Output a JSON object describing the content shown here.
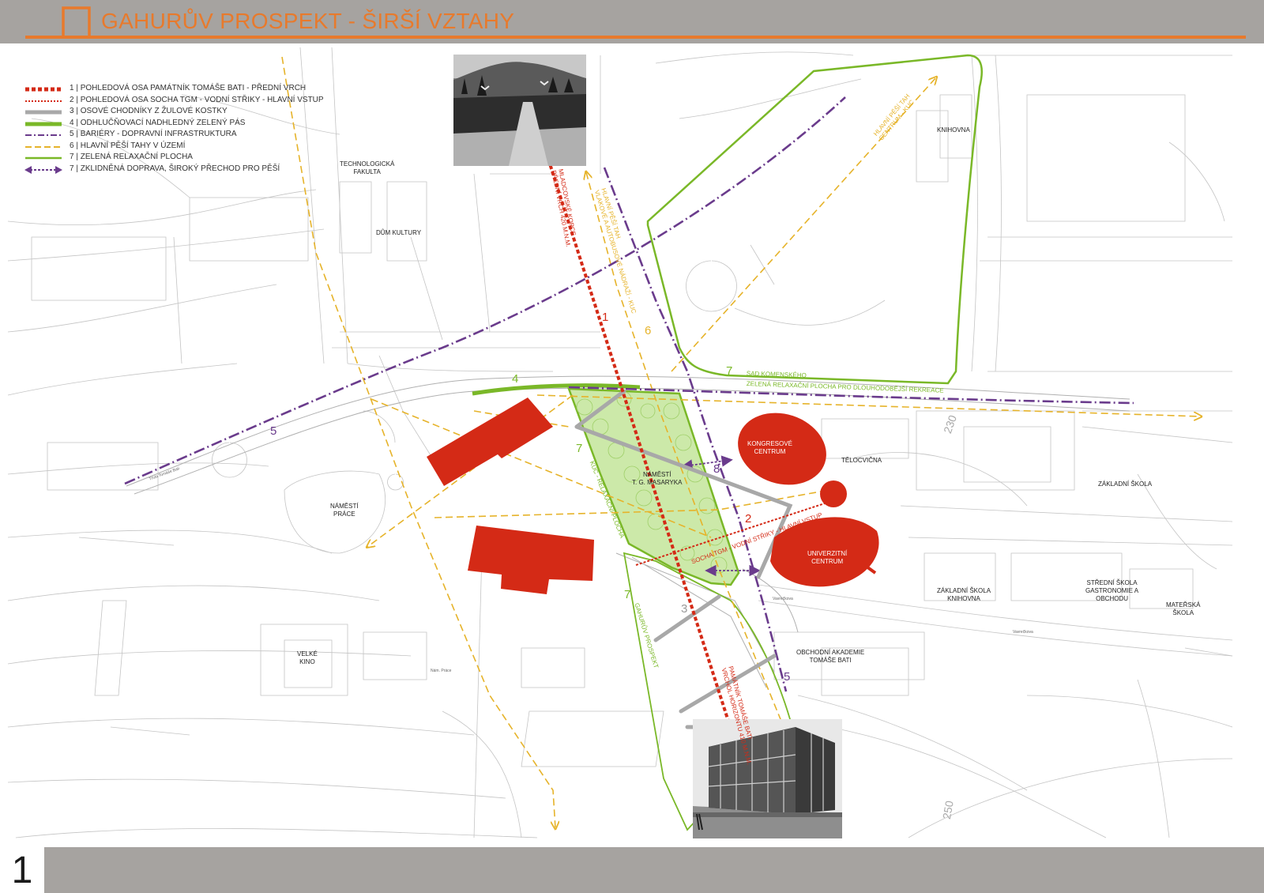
{
  "header": {
    "title": "GAHURŮV PROSPEKT - ŠIRŠÍ VZTAHY"
  },
  "footer": {
    "page_number": "1"
  },
  "colors": {
    "orange": "#e87a2c",
    "gray_bar": "#a6a3a0",
    "red": "#d42a16",
    "green": "#7ab828",
    "green_fill": "#c3e59a",
    "purple": "#6a3b8c",
    "yellow": "#e6b32a",
    "stone_gray": "#a8a8a8"
  },
  "legend": [
    {
      "label": "1 | POHLEDOVÁ OSA PAMÁTNÍK TOMÁŠE BATI - PŘEDNÍ VRCH",
      "style": "red-thick-dotted"
    },
    {
      "label": "2 | POHLEDOVÁ OSA SOCHA TGM - VODNÍ STŘIKY - HLAVNÍ VSTUP",
      "style": "red-thin-dotted"
    },
    {
      "label": "3 | OSOVÉ CHODNÍKY Z ŽULOVÉ KOSTKY",
      "style": "gray-thick"
    },
    {
      "label": "4 | ODHLUČŇOVACÍ NADHLEDNÝ ZELENÝ PÁS",
      "style": "green-thick"
    },
    {
      "label": "5 | BARIÉRY - DOPRAVNÍ INFRASTRUKTURA",
      "style": "purple-dashdot"
    },
    {
      "label": "6 | HLAVNÍ PĚŠÍ TAHY V ÚZEMÍ",
      "style": "yellow-dashed"
    },
    {
      "label": "7 | ZELENÁ RELAXAČNÍ PLOCHA",
      "style": "green-thin"
    },
    {
      "label": "7 | ZKLIDNĚNÁ DOPRAVA, ŠIROKÝ PŘECHOD PRO PĚŠÍ",
      "style": "purple-double-arrow"
    }
  ],
  "places": {
    "technologicka_fakulta": "TECHNOLOGICKÁ\nFAKULTA",
    "dum_kultury": "DŮM KULTURY",
    "knihovna": "KNIHOVNA",
    "kongresove_centrum": "KONGRESOVÉ\nCENTRUM",
    "telocvicna": "TĚLOCVIČNA",
    "zakladni_skola": "ZÁKLADNÍ ŠKOLA",
    "namesti_tgm": "NÁMĚSTÍ\nT. G. MASARYKA",
    "namesti_prace": "NÁMĚSTÍ\nPRÁCE",
    "univerzitni_centrum": "UNIVERZITNÍ\nCENTRUM",
    "zs_knihovna": "ZÁKLADNÍ ŠKOLA\nKNIHOVNA",
    "stredni_skola": "STŘEDNÍ ŠKOLA\nGASTRONOMIE A\nOBCHODU",
    "materska_skola": "MATEŘSKÁ\nŠKOLA",
    "velke_kino": "VELKÉ\nKINO",
    "obchodni_akademie": "OBCHODNÍ AKADEMIE\nTOMÁŠE BATI"
  },
  "annotations": {
    "sad_komenskeho": "SAD KOMENSKÉHO",
    "zelena_plocha": "ZELENÁ RELAXAČNÍ PLOCHA PRO DLOUHODOBĚJŠÍ REKREACE",
    "hlavni_tah_knihovna": "HLAVNÍ PĚŠÍ TAH\nCENTRUM - KUC",
    "mladcovske_kopce": "MLADCOVSKÉ KOPCE\nPŘEDNÍ VRCH 420 M.N.M.",
    "hlavni_tah_nadrazi": "HLAVNÍ PĚŠÍ TAH\nVLAKOVÉ A AUTOBUSOVÉ NÁDRAŽÍ - KUC",
    "kuc_relaxacni": "KUC - RELAXAČNÍ PLOCHA",
    "socha_tgm": "SOCHA TGM - VODNÍ STŘIKY - HLAVNÍ VSTUP",
    "gahuruv_prospekt": "GAHURŮV PROSPEKT",
    "pamatnik": "PAMÁTNÍK TOMÁŠE BATI\nVRCHOL HORIZONTU 410 M.N.M."
  },
  "axis_numbers": {
    "n1": "1",
    "n2": "2",
    "n3": "3",
    "n4": "4",
    "n5a": "5",
    "n5b": "5",
    "n6": "6",
    "n7a": "7",
    "n7b": "7",
    "n7c": "7",
    "n8": "8"
  },
  "small_labels": {
    "road_a": "Třída Tomáše Bati",
    "road_b": "Nám. Práce",
    "road_c": "Vavrečkova",
    "road_d": "Vavrečkova",
    "hill_a": "230",
    "hill_b": "250"
  }
}
